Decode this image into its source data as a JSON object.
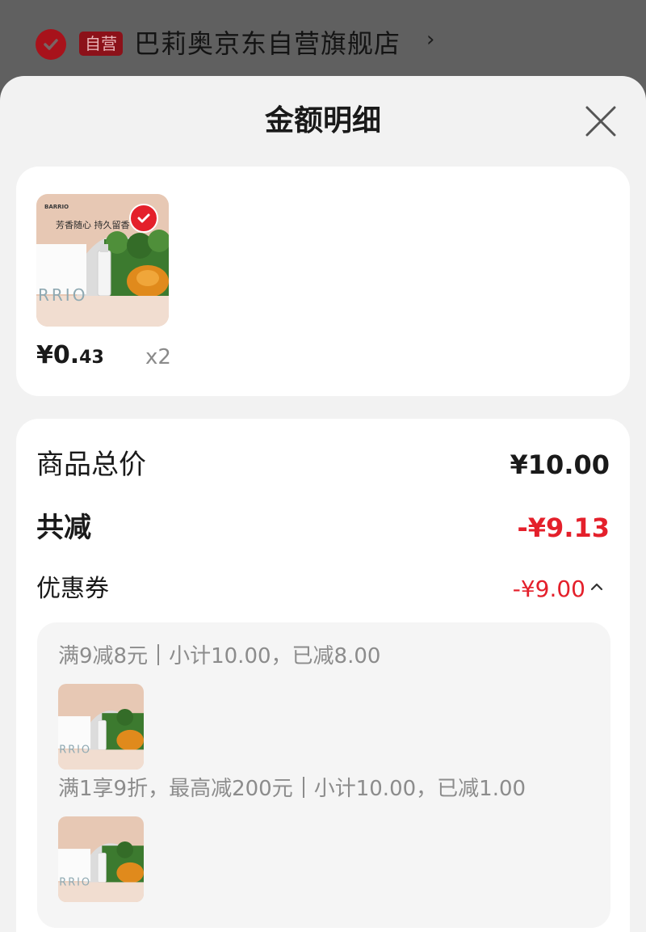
{
  "store": {
    "badge": "自营",
    "name": "巴莉奥京东自营旗舰店",
    "arrow": "›"
  },
  "sheet": {
    "title": "金额明细"
  },
  "product": {
    "image_brand": "BARRIO",
    "image_slogan": "芳香随心  持久留香",
    "image_watermark": "RRIO",
    "price_symbol": "¥",
    "price_int": "0.",
    "price_dec": "43",
    "quantity": "x2"
  },
  "summary": {
    "total_label": "商品总价",
    "total_value": "¥10.00",
    "reduce_label": "共减",
    "reduce_value": "-¥9.13",
    "coupon_label": "优惠券",
    "coupon_value": "-¥9.00"
  },
  "coupons": [
    {
      "rule": "满9减8元",
      "detail": "小计10.00，已减8.00"
    },
    {
      "rule": "满1享9折，最高减200元",
      "detail": "小计10.00，已减1.00"
    }
  ],
  "colors": {
    "accent_red": "#e4202b",
    "overlay_gray": "#5e5e5e",
    "sheet_bg": "#f2f2f2"
  },
  "icons": {
    "store_check": "check-circle-icon",
    "close": "close-icon",
    "coupon_toggle": "chevron-up-icon"
  }
}
